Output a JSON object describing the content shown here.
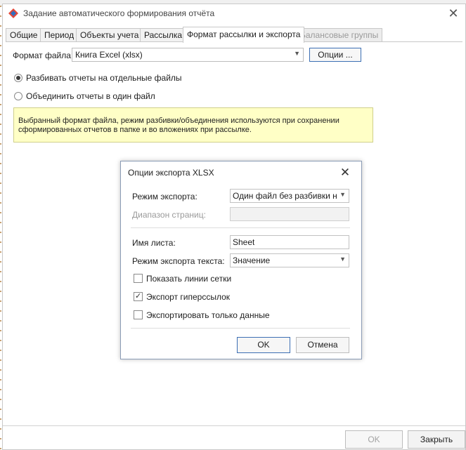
{
  "window": {
    "title": "Задание автоматического формирования отчёта",
    "close_label": "✕"
  },
  "tabs": [
    {
      "label": "Общие",
      "state": "normal"
    },
    {
      "label": "Период",
      "state": "normal"
    },
    {
      "label": "Объекты учета",
      "state": "normal"
    },
    {
      "label": "Рассылка",
      "state": "normal"
    },
    {
      "label": "Формат рассылки и экспорта",
      "state": "active"
    },
    {
      "label": "Балансовые группы",
      "state": "disabled"
    }
  ],
  "format": {
    "label": "Формат файла:",
    "value": "Книга Excel (xlsx)",
    "options_button": "Опции ..."
  },
  "split": {
    "option_separate": "Разбивать отчеты на отдельные файлы",
    "option_single": "Объединить отчеты в один файл",
    "selected": "separate"
  },
  "note": {
    "text": "Выбранный формат файла, режим разбивки/объединения используются при сохранении сформированных отчетов в папке и во вложениях при рассылке."
  },
  "footer": {
    "ok_label": "OK",
    "close_label": "Закрыть"
  },
  "dialog": {
    "title": "Опции экспорта XLSX",
    "close_label": "✕",
    "export_mode_label": "Режим экспорта:",
    "export_mode_value": "Один файл без разбивки на",
    "page_range_label": "Диапазон страниц:",
    "page_range_value": "",
    "sheet_name_label": "Имя листа:",
    "sheet_name_value": "Sheet",
    "text_mode_label": "Режим экспорта текста:",
    "text_mode_value": "Значение",
    "show_grid_label": "Показать линии сетки",
    "show_grid_checked": false,
    "export_links_label": "Экспорт гиперссылок",
    "export_links_checked": true,
    "data_only_label": "Экспортировать только данные",
    "data_only_checked": false,
    "ok_label": "OK",
    "cancel_label": "Отмена"
  },
  "colors": {
    "accent": "#3c6fb4",
    "note_bg": "#ffffc6"
  }
}
